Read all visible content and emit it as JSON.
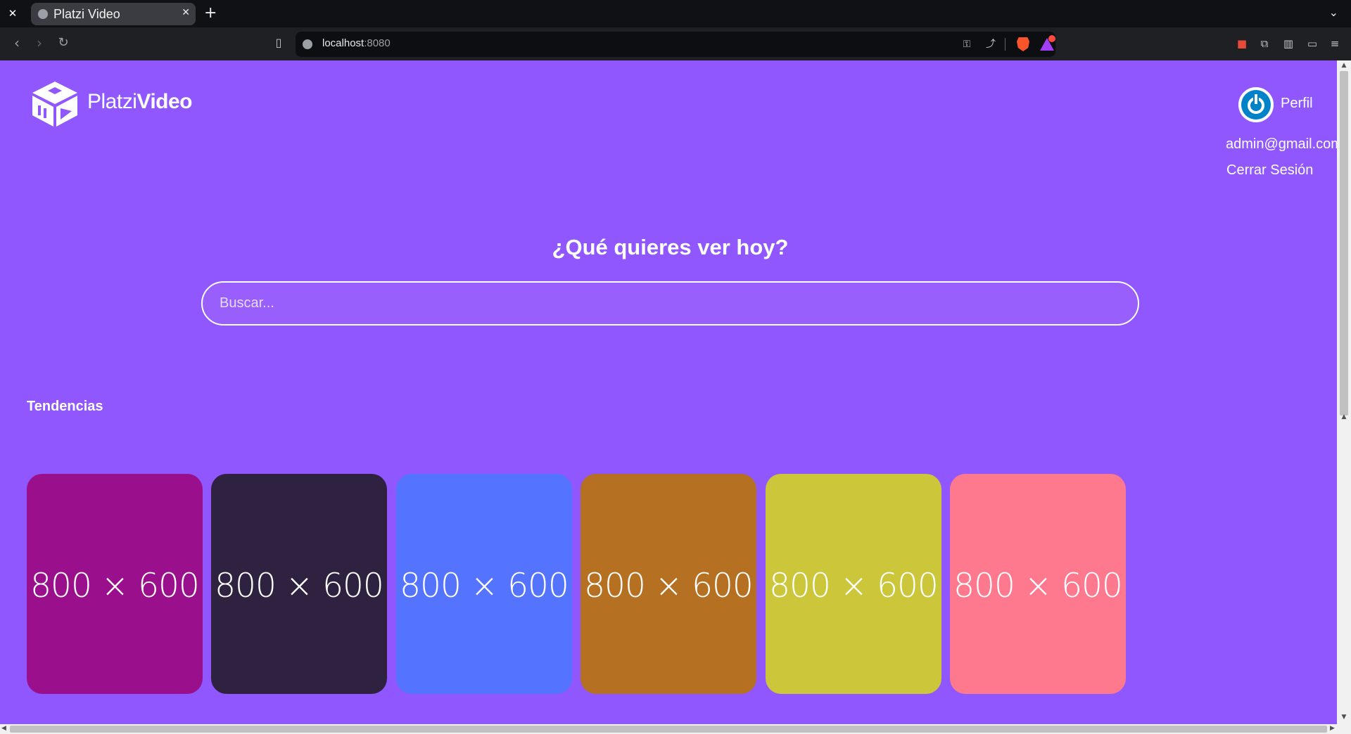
{
  "browser": {
    "tab_close_window": "✕",
    "tab": {
      "title": "Platzi Video",
      "close": "✕"
    },
    "new_tab": "+",
    "tab_dropdown": "⌄",
    "url": {
      "host": "localhost",
      "port": ":8080"
    },
    "icons": {
      "back": "‹",
      "forward": "›",
      "reload": "↻",
      "bookmark": "▯",
      "key": "⚿",
      "share": "⤴",
      "extensions": "⧉",
      "sidebar": "▥",
      "wallet": "▭",
      "menu": "≡"
    }
  },
  "header": {
    "logo": {
      "text_light": "Platzi",
      "text_bold": "Video"
    },
    "profile": {
      "label": "Perfil"
    },
    "user_email": "admin@gmail.com",
    "logout": "Cerrar Sesión"
  },
  "hero": {
    "title": "¿Qué quieres ver hoy?",
    "search_placeholder": "Buscar..."
  },
  "trends": {
    "title": "Tendencias",
    "items": [
      {
        "label": "800 × 600",
        "color": "#9a108c"
      },
      {
        "label": "800 × 600",
        "color": "#2e2240"
      },
      {
        "label": "800 × 600",
        "color": "#5473ff"
      },
      {
        "label": "800 × 600",
        "color": "#b57021"
      },
      {
        "label": "800 × 600",
        "color": "#cbc63a"
      },
      {
        "label": "800 × 600",
        "color": "#fe788e"
      }
    ]
  },
  "colors": {
    "page_bg": "#8f57fd",
    "accent": "#ffffff"
  }
}
